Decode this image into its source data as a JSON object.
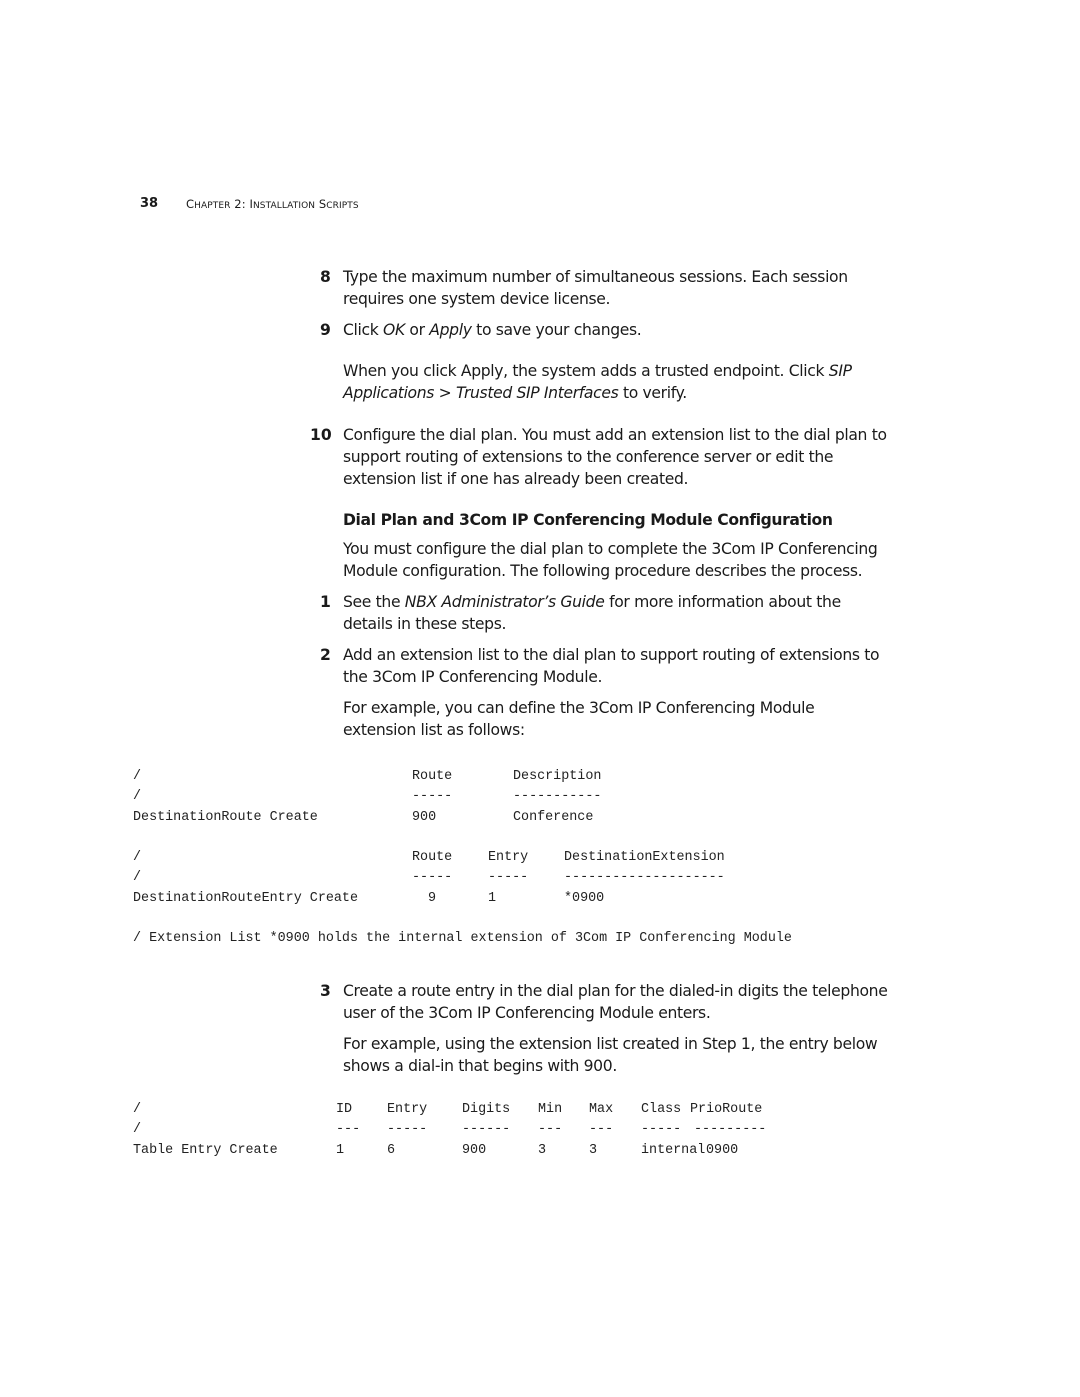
{
  "header": {
    "page_number": "38",
    "chapter_prefix_C": "C",
    "chapter_rest_1": "hapter",
    "chapter_num": " 2: ",
    "chapter_I": "I",
    "chapter_rest_2": "nstallation",
    "chapter_S": " S",
    "chapter_rest_3": "cripts"
  },
  "step8": {
    "number": "8",
    "line1": "Type the maximum number of simultaneous sessions. Each session",
    "line2": "requires one system device license."
  },
  "step9": {
    "number": "9",
    "pre": "Click ",
    "ok": "OK",
    "mid": " or ",
    "apply": "Apply",
    "post": " to save your changes.",
    "note_line1_pre": "When you click Apply, the system adds a trusted endpoint. Click ",
    "note_line1_em": "SIP",
    "note_line2_em": "Applications > Trusted SIP Interfaces",
    "note_line2_post": " to verify."
  },
  "step10": {
    "number": "10",
    "line1": "Configure the dial plan. You must add an extension list to the dial plan to",
    "line2": "support routing of extensions to the conference server or edit the",
    "line3": "extension list if one has already been created."
  },
  "section": {
    "heading": "Dial Plan and 3Com IP Conferencing Module Configuration",
    "intro_line1": "You must configure the dial plan to complete the 3Com IP Conferencing",
    "intro_line2": "Module configuration. The following procedure describes the process."
  },
  "substep1": {
    "number": "1",
    "pre": "See the ",
    "em": "NBX Administrator’s Guide",
    "post": " for more information about the",
    "line2": "details in these steps."
  },
  "substep2": {
    "number": "2",
    "line1": "Add an extension list to the dial plan to support routing of extensions to",
    "line2": "the 3Com IP Conferencing Module.",
    "example_line1": "For example, you can define the 3Com IP Conferencing Module",
    "example_line2": "extension list as follows:"
  },
  "code_route": {
    "header": {
      "slash": "/",
      "route": "Route",
      "description": "Description"
    },
    "divider": {
      "slash": "/",
      "route": "-----",
      "description": "-----------"
    },
    "row": {
      "command": "DestinationRoute Create",
      "route": "900",
      "description": "Conference"
    }
  },
  "code_route_entry": {
    "header": {
      "slash": "/",
      "route": "Route",
      "entry": "Entry",
      "destination": "DestinationExtension"
    },
    "divider": {
      "slash": "/",
      "route": "-----",
      "entry": "-----",
      "destination": "--------------------"
    },
    "row": {
      "command": "DestinationRouteEntry Create",
      "route": "9",
      "entry": "1",
      "destination": "*0900"
    }
  },
  "code_comment": "/ Extension List *0900 holds the internal extension of 3Com IP Conferencing Module",
  "substep3": {
    "number": "3",
    "line1": "Create a route entry in the dial plan for the dialed-in digits the telephone",
    "line2": "user of the 3Com IP Conferencing Module enters.",
    "example_line1": "For example, using the extension list created in Step 1, the entry below",
    "example_line2": "shows a dial-in that begins with 900."
  },
  "code_table": {
    "header": {
      "slash": "/",
      "id": "ID",
      "entry": "Entry",
      "digits": "Digits",
      "min": "Min",
      "max": "Max",
      "class": "Class",
      "prio_route": "PrioRoute"
    },
    "divider": {
      "slash": "/",
      "id": "---",
      "entry": "-----",
      "digits": "------",
      "min": "---",
      "max": "---",
      "class": "-----",
      "prio_route": "---------"
    },
    "row": {
      "command": "Table Entry Create",
      "id": "1",
      "entry": "6",
      "digits": "900",
      "min": "3",
      "max": "3",
      "class": "internal",
      "prio_route": "0900"
    }
  }
}
